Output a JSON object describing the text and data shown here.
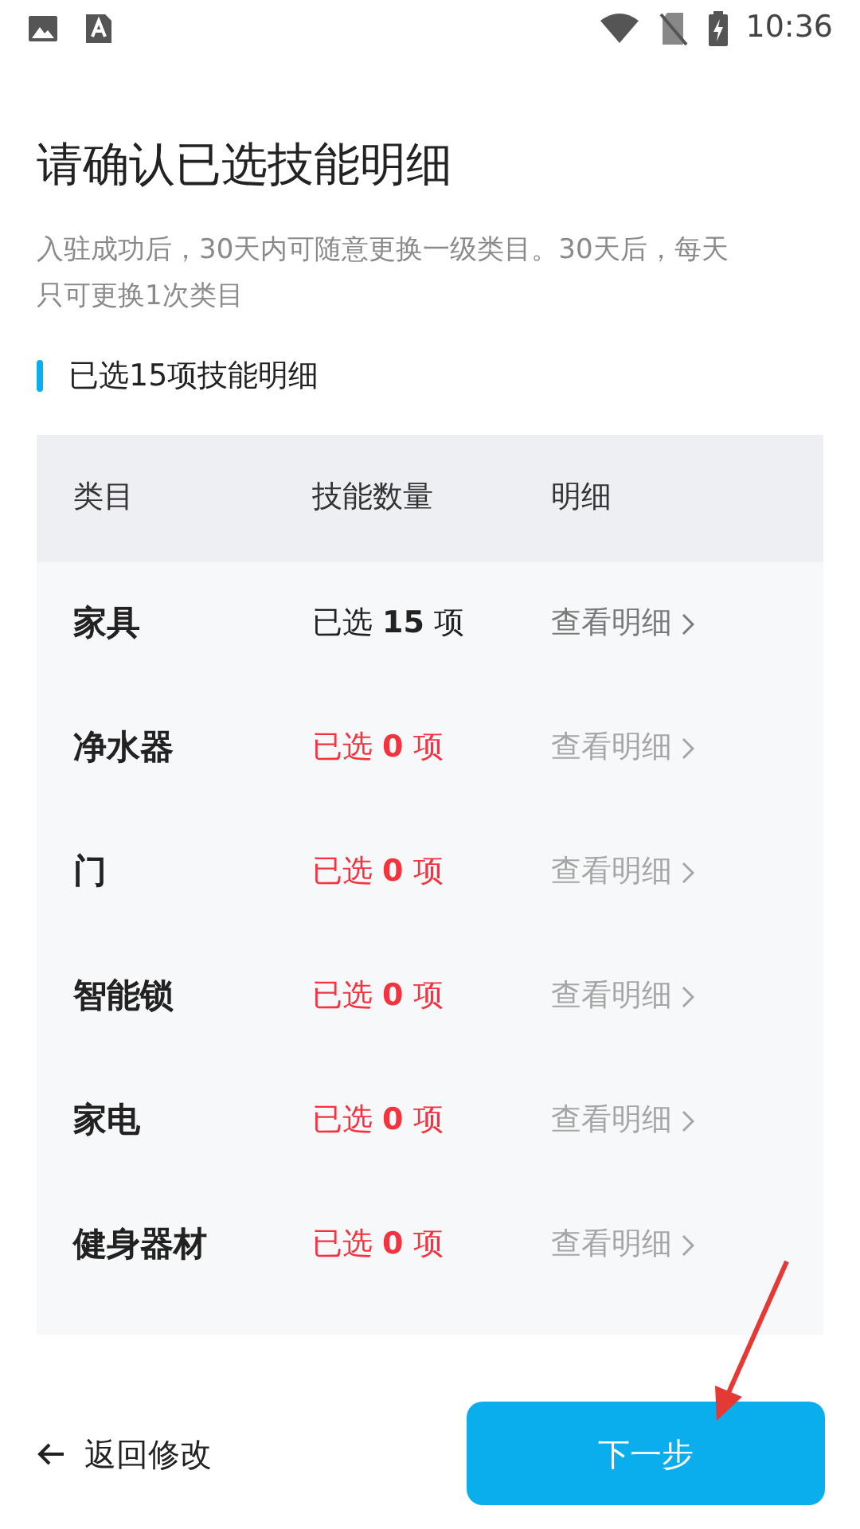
{
  "status_bar": {
    "time": "10:36"
  },
  "title": "请确认已选技能明细",
  "notice": "入驻成功后，30天内可随意更换一级类目。30天后，每天只可更换1次类目",
  "section": {
    "label": "已选15项技能明细"
  },
  "table": {
    "columns": [
      "类目",
      "技能数量",
      "明细"
    ],
    "rows": [
      {
        "category": "家具",
        "count": "已选 **15** 项",
        "empty": false,
        "detail": "查看明细",
        "disabled": false
      },
      {
        "category": "净水器",
        "count": "已选 **0** 项",
        "empty": true,
        "detail": "查看明细",
        "disabled": true
      },
      {
        "category": "门",
        "count": "已选 **0** 项",
        "empty": true,
        "detail": "查看明细",
        "disabled": true
      },
      {
        "category": "智能锁",
        "count": "已选 **0** 项",
        "empty": true,
        "detail": "查看明细",
        "disabled": true
      },
      {
        "category": "家电",
        "count": "已选 **0** 项",
        "empty": true,
        "detail": "查看明细",
        "disabled": true
      },
      {
        "category": "健身器材",
        "count": "已选 **0** 项",
        "empty": true,
        "detail": "查看明细",
        "disabled": true
      }
    ]
  },
  "footer": {
    "back": "返回修改",
    "next": "下一步"
  }
}
